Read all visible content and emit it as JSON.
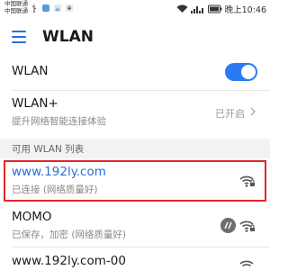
{
  "status_bar": {
    "carrier_1": "中国联通",
    "carrier_2": "中国联通",
    "battery": "",
    "time": "晚上10:46"
  },
  "toolbar": {
    "title": "WLAN"
  },
  "settings": {
    "wlan_label": "WLAN",
    "wlan_enabled": true,
    "wlan_plus_label": "WLAN+",
    "wlan_plus_desc": "提升网络智能连接体验",
    "wlan_plus_status": "已开启"
  },
  "section": {
    "available_label": "可用 WLAN 列表"
  },
  "networks": [
    {
      "ssid": "www.192ly.com",
      "status": "已连接 (网络质量好)"
    },
    {
      "ssid": "MOMO",
      "status": "已保存，加密 (网络质量好)"
    },
    {
      "ssid": "www.192ly.com-00",
      "status": ""
    }
  ],
  "colors": {
    "accent": "#2a6fd6",
    "toggle_on": "#2a7af3",
    "highlight_border": "#e0252b",
    "connected_text": "#2a6fd6"
  }
}
